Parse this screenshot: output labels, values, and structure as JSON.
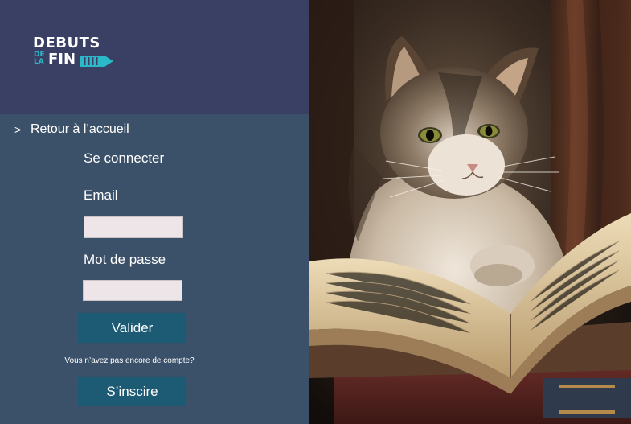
{
  "brand": {
    "logo_line1": "DEBUTS",
    "logo_small": "DE LA",
    "logo_line2": "FIN",
    "accent_color": "#2bb8c9"
  },
  "nav": {
    "back_chevron": ">",
    "back_label": "Retour à l’accueil"
  },
  "login_form": {
    "title": "Se connecter",
    "email_label": "Email",
    "email_value": "",
    "password_label": "Mot de passe",
    "password_value": "",
    "submit_label": "Valider",
    "no_account_text": "Vous n’avez pas encore de compte?",
    "signup_label": "S’inscire"
  },
  "colors": {
    "header_bg": "#3a3f64",
    "panel_bg": "#3b5069",
    "button_bg": "#1d5a73",
    "input_bg": "#ede5e8"
  },
  "hero": {
    "image_subject": "cat-reading-book-illustration"
  }
}
